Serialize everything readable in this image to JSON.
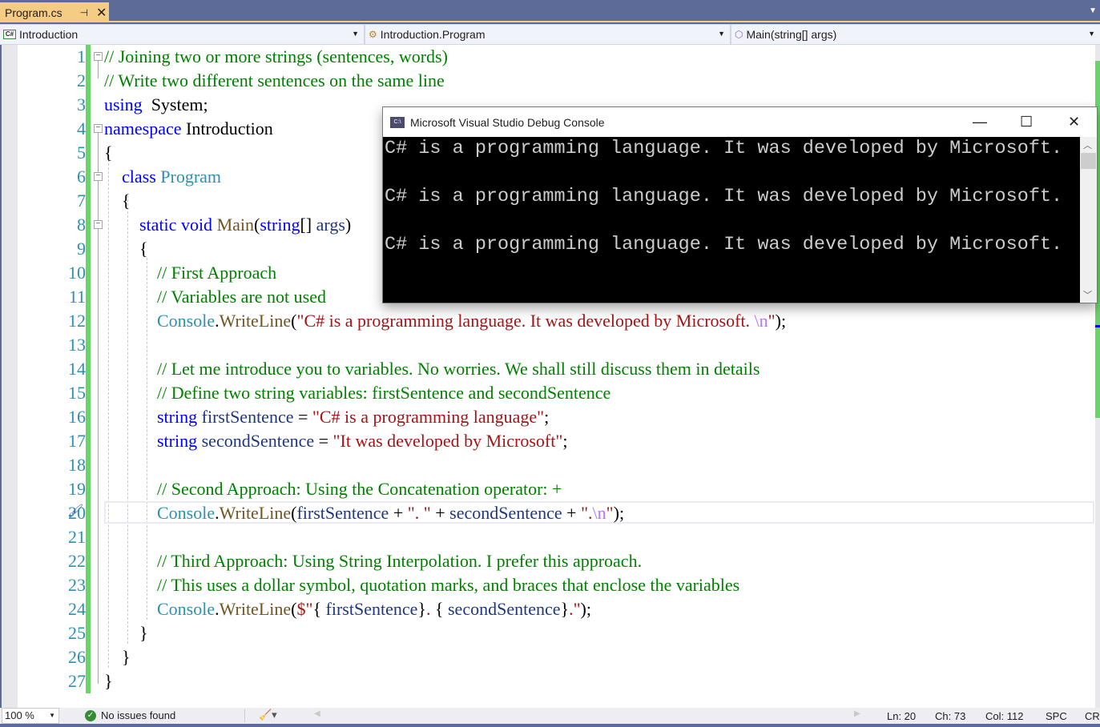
{
  "tab": {
    "title": "Program.cs",
    "pin_icon": "pin-icon",
    "close_icon": "close-icon"
  },
  "navbar": {
    "project": "Introduction",
    "type": "Introduction.Program",
    "member": "Main(string[] args)"
  },
  "editor": {
    "lines": [
      {
        "n": "1",
        "tokens": [
          [
            "cm",
            "// Joining two or more strings (sentences, words)"
          ]
        ]
      },
      {
        "n": "2",
        "tokens": [
          [
            "cm",
            "// Write two different sentences on the same line"
          ]
        ]
      },
      {
        "n": "3",
        "tokens": [
          [
            "kw",
            "using"
          ],
          [
            "",
            "  System;"
          ]
        ]
      },
      {
        "n": "4",
        "tokens": [
          [
            "kw",
            "namespace"
          ],
          [
            "",
            " Introduction"
          ]
        ]
      },
      {
        "n": "5",
        "tokens": [
          [
            "",
            "{"
          ]
        ]
      },
      {
        "n": "6",
        "tokens": [
          [
            "",
            "    "
          ],
          [
            "kw",
            "class"
          ],
          [
            "",
            " "
          ],
          [
            "ty",
            "Program"
          ]
        ]
      },
      {
        "n": "7",
        "tokens": [
          [
            "",
            "    {"
          ]
        ]
      },
      {
        "n": "8",
        "tokens": [
          [
            "",
            "        "
          ],
          [
            "kw",
            "static"
          ],
          [
            "",
            " "
          ],
          [
            "kw",
            "void"
          ],
          [
            "",
            " "
          ],
          [
            "mt",
            "Main"
          ],
          [
            "",
            "("
          ],
          [
            "kw",
            "string"
          ],
          [
            "",
            "[] "
          ],
          [
            "id",
            "args"
          ],
          [
            "",
            ")"
          ]
        ]
      },
      {
        "n": "9",
        "tokens": [
          [
            "",
            "        {"
          ]
        ]
      },
      {
        "n": "10",
        "tokens": [
          [
            "",
            "            "
          ],
          [
            "cm",
            "// First Approach"
          ]
        ]
      },
      {
        "n": "11",
        "tokens": [
          [
            "",
            "            "
          ],
          [
            "cm",
            "// Variables are not used"
          ]
        ]
      },
      {
        "n": "12",
        "tokens": [
          [
            "",
            "            "
          ],
          [
            "ty",
            "Console"
          ],
          [
            "",
            "."
          ],
          [
            "mt",
            "WriteLine"
          ],
          [
            "",
            "("
          ],
          [
            "st",
            "\"C# is a programming language. It was developed by Microsoft. "
          ],
          [
            "esc",
            "\\n"
          ],
          [
            "st",
            "\""
          ],
          [
            "",
            ");"
          ]
        ]
      },
      {
        "n": "13",
        "tokens": []
      },
      {
        "n": "14",
        "tokens": [
          [
            "",
            "            "
          ],
          [
            "cm",
            "// Let me introduce you to variables. No worries. We shall still discuss them in details"
          ]
        ]
      },
      {
        "n": "15",
        "tokens": [
          [
            "",
            "            "
          ],
          [
            "cm",
            "// Define two string variables: firstSentence and secondSentence"
          ]
        ]
      },
      {
        "n": "16",
        "tokens": [
          [
            "",
            "            "
          ],
          [
            "kw",
            "string"
          ],
          [
            "",
            " "
          ],
          [
            "id",
            "firstSentence"
          ],
          [
            "",
            " = "
          ],
          [
            "st",
            "\"C# is a programming language\""
          ],
          [
            "",
            ";"
          ]
        ]
      },
      {
        "n": "17",
        "tokens": [
          [
            "",
            "            "
          ],
          [
            "kw",
            "string"
          ],
          [
            "",
            " "
          ],
          [
            "id",
            "secondSentence"
          ],
          [
            "",
            " = "
          ],
          [
            "st",
            "\"It was developed by Microsoft\""
          ],
          [
            "",
            ";"
          ]
        ]
      },
      {
        "n": "18",
        "tokens": []
      },
      {
        "n": "19",
        "tokens": [
          [
            "",
            "            "
          ],
          [
            "cm",
            "// Second Approach: Using the Concatenation operator: +"
          ]
        ]
      },
      {
        "n": "20",
        "tokens": [
          [
            "",
            "            "
          ],
          [
            "ty",
            "Console"
          ],
          [
            "",
            "."
          ],
          [
            "mt",
            "WriteLine"
          ],
          [
            "",
            "("
          ],
          [
            "id",
            "firstSentence"
          ],
          [
            "",
            " + "
          ],
          [
            "st",
            "\". \""
          ],
          [
            "",
            " + "
          ],
          [
            "id",
            "secondSentence"
          ],
          [
            "",
            " + "
          ],
          [
            "st",
            "\"."
          ],
          [
            "esc",
            "\\n"
          ],
          [
            "st",
            "\""
          ],
          [
            "",
            ");"
          ]
        ]
      },
      {
        "n": "21",
        "tokens": []
      },
      {
        "n": "22",
        "tokens": [
          [
            "",
            "            "
          ],
          [
            "cm",
            "// Third Approach: Using String Interpolation. I prefer this approach."
          ]
        ]
      },
      {
        "n": "23",
        "tokens": [
          [
            "",
            "            "
          ],
          [
            "cm",
            "// This uses a dollar symbol, quotation marks, and braces that enclose the variables"
          ]
        ]
      },
      {
        "n": "24",
        "tokens": [
          [
            "",
            "            "
          ],
          [
            "ty",
            "Console"
          ],
          [
            "",
            "."
          ],
          [
            "mt",
            "WriteLine"
          ],
          [
            "",
            "("
          ],
          [
            "st",
            "$\""
          ],
          [
            "",
            "{ "
          ],
          [
            "id",
            "firstSentence"
          ],
          [
            "",
            "}"
          ],
          [
            "st",
            ". "
          ],
          [
            "",
            "{ "
          ],
          [
            "id",
            "secondSentence"
          ],
          [
            "",
            "}"
          ],
          [
            "st",
            ".\""
          ],
          [
            "",
            ");"
          ]
        ]
      },
      {
        "n": "25",
        "tokens": [
          [
            "",
            "        }"
          ]
        ]
      },
      {
        "n": "26",
        "tokens": [
          [
            "",
            "    }"
          ]
        ]
      },
      {
        "n": "27",
        "tokens": [
          [
            "",
            "}"
          ]
        ]
      }
    ]
  },
  "console": {
    "title": "Microsoft Visual Studio Debug Console",
    "icon_label": "C:\\",
    "lines": [
      "C# is a programming language. It was developed by Microsoft.",
      "C# is a programming language. It was developed by Microsoft.",
      "C# is a programming language. It was developed by Microsoft."
    ]
  },
  "statusbar": {
    "zoom": "100 %",
    "issues": "No issues found",
    "ln": "Ln: 20",
    "ch": "Ch: 73",
    "col": "Col: 112",
    "spacing": "SPC",
    "line_ending": "CRLF"
  }
}
